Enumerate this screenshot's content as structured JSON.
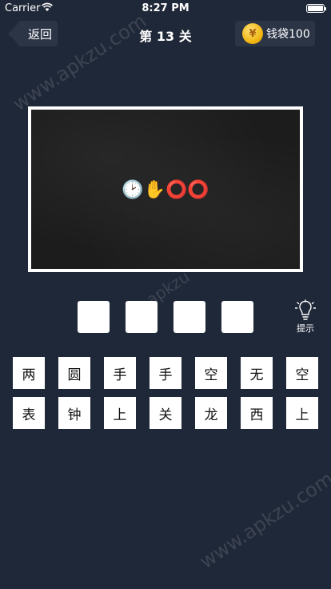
{
  "status_bar": {
    "carrier": "Carrier",
    "time": "8:27 PM"
  },
  "nav": {
    "back_label": "返回",
    "title": "第 13 关",
    "wallet_label": "钱袋100",
    "coin_symbol": "¥"
  },
  "puzzle": {
    "emojis": "🕑✋⭕⭕"
  },
  "answer_slots": [
    "",
    "",
    "",
    ""
  ],
  "hint": {
    "label": "提示"
  },
  "char_tiles": {
    "row1": [
      "两",
      "圆",
      "手",
      "手",
      "空",
      "无",
      "空"
    ],
    "row2": [
      "表",
      "钟",
      "上",
      "关",
      "龙",
      "西",
      "上"
    ]
  },
  "watermarks": [
    "www.apkzu.com",
    "apkzu",
    "www.apkzu.com"
  ]
}
